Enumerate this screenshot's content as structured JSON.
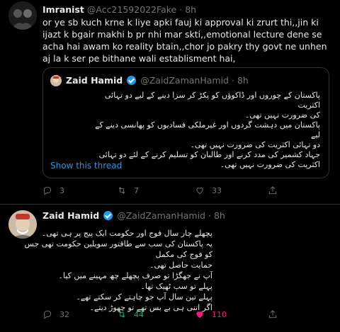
{
  "tweet1": {
    "display_name": "Imranist",
    "handle": "@Acc21592022Fake",
    "separator": "·",
    "time": "8h",
    "text": "or ye sb kuch krne k liye apki fauj ki approval ki zrurt thi,,jin ki ijazt k bgair makhi b pr nhi mar skti,,emotional lecture dene se acha hai awam ko reality btain,,chor jo pakry thy govt ne unhen aj la k ser pe bithane wali establisment hai,",
    "quote": {
      "display_name": "Zaid Hamid",
      "handle": "@ZaidZamanHamid",
      "separator": "·",
      "time": "8h",
      "lines": [
        "پاکستان کے چوروں اور ڈاکوؤں کو پکڑ کر سزا دینے کے لیے دو تہائی اکثریت",
        "کی ضرورت نہیں تھی۔",
        "پاکستان میں دہشت گردوں اور غیرملکی فسادیوں کو پھانسی دینے کے لیے",
        "دو تہائی اکثریت کی ضرورت نہیں تھی۔",
        "جہاد کشمیر کی مدد کرنے اور طالبان کو تسلیم کرنے کے لئے دو تہائی",
        "اکثریت کی ضرورت نہیں تھی۔"
      ],
      "show_thread": "Show this thread"
    },
    "actions": {
      "replies": "3",
      "retweets": "7",
      "likes": "33"
    }
  },
  "tweet2": {
    "display_name": "Zaid Hamid",
    "handle": "@ZaidZamanHamid",
    "separator": "·",
    "time": "8h",
    "lines": [
      "پچھلے چار سال فوج اور حکومت ایک پیج پر ہی تھی۔",
      "یہ پاکستان کی سب سے طاقتور سویلین حکومت تھی جس کو فوج کی مکمل",
      "حمایت حاصل تھی۔",
      "آپ نے جھگڑا تو صرف پچھلے چھ مہینے میں کیا۔",
      "پہلے تو سب ٹھیک تھا۔",
      "پہلے تین سال آپ جو چاہتے کر سکتے تھے۔",
      "اگر اتنی ہی بے بس تھے تو چھوڑ دیتے۔"
    ],
    "actions": {
      "replies": "32",
      "retweets": "44",
      "likes": "110"
    }
  },
  "colors": {
    "accent": "#1d9bf0",
    "retweet": "#00ba7c",
    "like": "#f91880",
    "muted": "#71767b"
  },
  "icons": [
    "reply-icon",
    "retweet-icon",
    "like-icon",
    "share-icon",
    "verified-badge-icon"
  ]
}
